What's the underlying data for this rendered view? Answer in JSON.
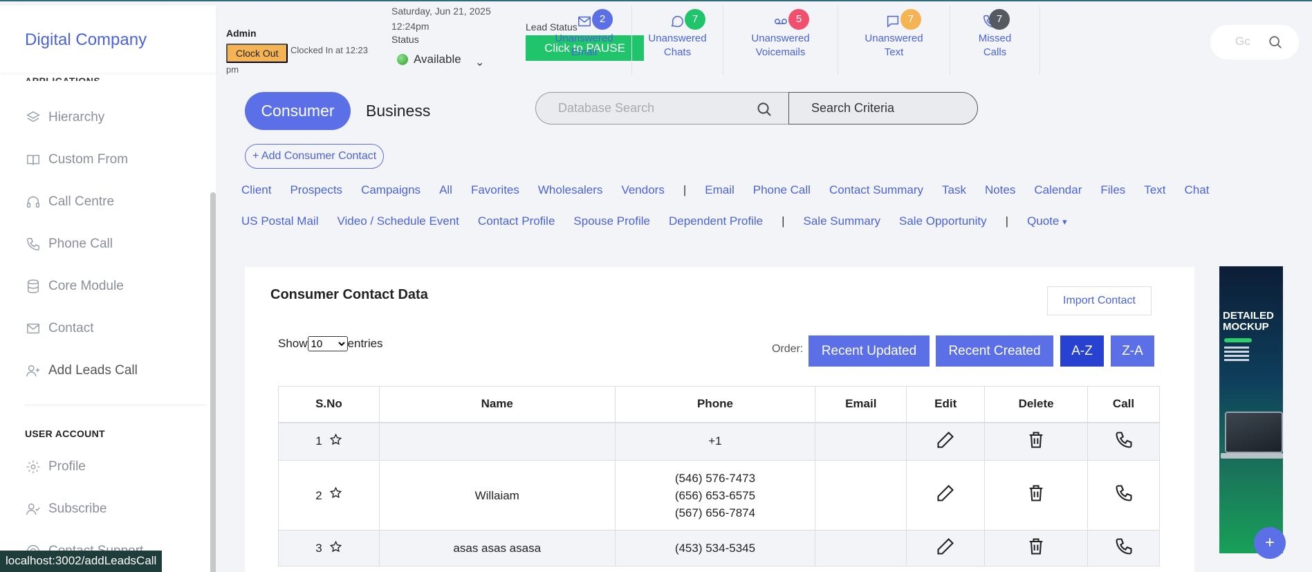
{
  "brand": {
    "title": "Digital Company"
  },
  "sidebar": {
    "cutoff_label": "APPLICATIONS",
    "items": [
      {
        "label": "Hierarchy",
        "icon": "layers-icon"
      },
      {
        "label": "Custom From",
        "icon": "book-icon"
      },
      {
        "label": "Call Centre",
        "icon": "headphones-icon"
      },
      {
        "label": "Phone Call",
        "icon": "phone-icon"
      },
      {
        "label": "Core Module",
        "icon": "database-icon"
      },
      {
        "label": "Contact",
        "icon": "mail-icon"
      },
      {
        "label": "Add Leads Call",
        "icon": "user-plus-icon"
      }
    ],
    "section_user": "USER ACCOUNT",
    "user_items": [
      {
        "label": "Profile",
        "icon": "gear-icon"
      },
      {
        "label": "Subscribe",
        "icon": "user-check-icon"
      },
      {
        "label": "Contact Support",
        "icon": "support-icon"
      }
    ]
  },
  "status_bar": {
    "url": "localhost:3002/addLeadsCall"
  },
  "header": {
    "admin": "Admin",
    "clock_out": "Clock Out",
    "clocked_in": "Clocked In at 12:23",
    "clocked_pm": "pm",
    "date": "Saturday, Jun 21, 2025",
    "time": "12:24pm",
    "status_label": "Status",
    "availability": "Available",
    "lead_status_label": "Lead Status",
    "pause_button": "Click to PAUSE",
    "stats": [
      {
        "line1": "Unanswered",
        "line2": "Email",
        "count": "2",
        "color": "#5b6fe6",
        "icon": "mail-icon"
      },
      {
        "line1": "Unanswered",
        "line2": "Chats",
        "count": "7",
        "color": "#1fc46b",
        "icon": "chat-icon"
      },
      {
        "line1": "Unanswered",
        "line2": "Voicemails",
        "count": "5",
        "color": "#f0506e",
        "icon": "voicemail-icon"
      },
      {
        "line1": "Unanswered",
        "line2": "Text",
        "count": "7",
        "color": "#f5b453",
        "icon": "message-icon"
      },
      {
        "line1": "Missed",
        "line2": "Calls",
        "count": "7",
        "color": "#555a62",
        "icon": "phone-icon"
      }
    ],
    "search_placeholder": "Gc"
  },
  "main": {
    "segments": [
      "Consumer",
      "Business"
    ],
    "db_search_placeholder": "Database Search",
    "search_criteria": "Search Criteria",
    "add_contact": "+ Add Consumer Contact",
    "nav_row1": [
      "Client",
      "Prospects",
      "Campaigns",
      "All",
      "Favorites",
      "Wholesalers",
      "Vendors",
      "|",
      "Email",
      "Phone Call",
      "Contact Summary",
      "Task",
      "Notes",
      "Calendar",
      "Files",
      "Text",
      "Chat"
    ],
    "nav_row2": [
      "US Postal Mail",
      "Video / Schedule Event",
      "Contact Profile",
      "Spouse Profile",
      "Dependent Profile",
      "|",
      "Sale Summary",
      "Sale Opportunity",
      "|",
      "Quote"
    ]
  },
  "card": {
    "title": "Consumer Contact Data",
    "import_button": "Import Contact",
    "show_label": "Show",
    "entries_value": "10",
    "entries_label": "entries",
    "order_label": "Order:",
    "order_buttons": [
      "Recent Updated",
      "Recent Created",
      "A-Z",
      "Z-A"
    ],
    "columns": [
      "S.No",
      "Name",
      "Phone",
      "Email",
      "Edit",
      "Delete",
      "Call"
    ],
    "rows": [
      {
        "sno": "1",
        "name": "",
        "phones": [
          "+1"
        ],
        "email": ""
      },
      {
        "sno": "2",
        "name": "Willaiam",
        "phones": [
          "(546) 576-7473",
          "(656) 653-6575",
          "(567) 656-7874"
        ],
        "email": ""
      },
      {
        "sno": "3",
        "name": "asas asas asasa",
        "phones": [
          "(453) 534-5345"
        ],
        "email": ""
      }
    ]
  },
  "ad": {
    "title_line1": "DETAILED",
    "title_line2": "MOCKUP"
  },
  "fab": "+"
}
